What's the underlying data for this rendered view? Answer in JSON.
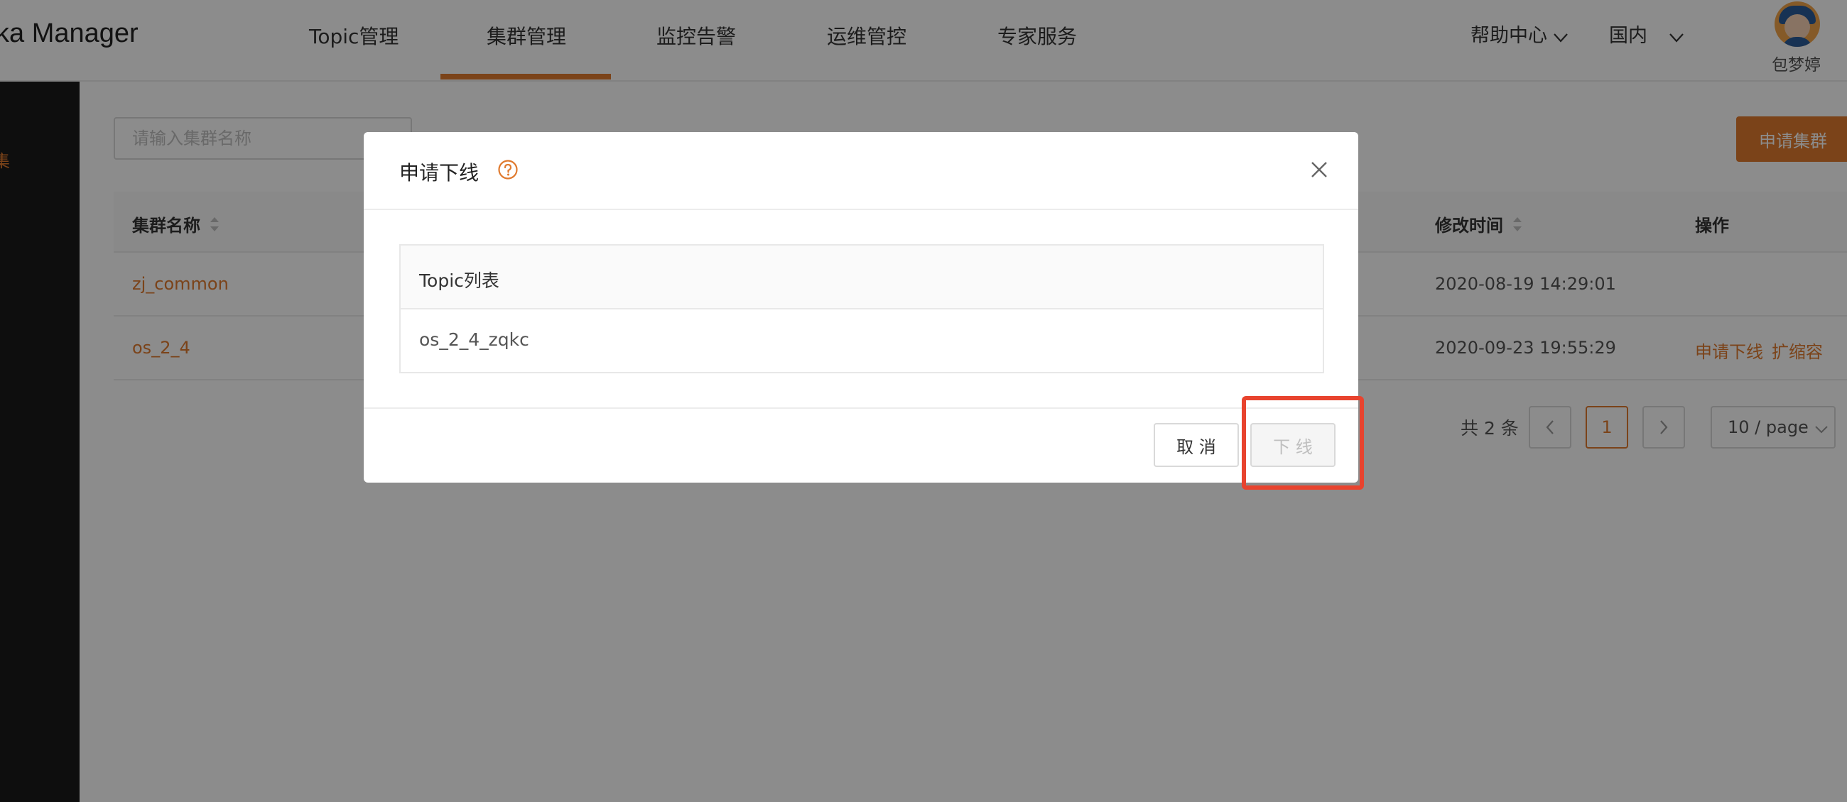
{
  "header": {
    "logo_text": "ka Manager",
    "nav": [
      {
        "label": "Topic管理"
      },
      {
        "label": "集群管理"
      },
      {
        "label": "监控告警"
      },
      {
        "label": "运维管控"
      },
      {
        "label": "专家服务"
      }
    ],
    "help_label": "帮助中心",
    "region_label": "国内",
    "username": "包梦婷"
  },
  "sidebar": {
    "active_stub": "集"
  },
  "toolbar": {
    "search_placeholder": "请输入集群名称",
    "apply_button": "申请集群"
  },
  "table": {
    "columns": {
      "name": "集群名称",
      "modified": "修改时间",
      "actions": "操作"
    },
    "rows": [
      {
        "name": "zj_common",
        "modified": "2020-08-19 14:29:01",
        "actions": []
      },
      {
        "name": "os_2_4",
        "modified": "2020-09-23 19:55:29",
        "actions": [
          "申请下线",
          "扩缩容"
        ]
      }
    ]
  },
  "pagination": {
    "total_text": "共 2 条",
    "current_page": "1",
    "page_size": "10 / page"
  },
  "modal": {
    "title": "申请下线",
    "list_header": "Topic列表",
    "topics": [
      "os_2_4_zqkc"
    ],
    "cancel_label": "取 消",
    "confirm_label": "下 线"
  },
  "colors": {
    "accent": "#e07a2e",
    "highlight": "#e8432e"
  }
}
